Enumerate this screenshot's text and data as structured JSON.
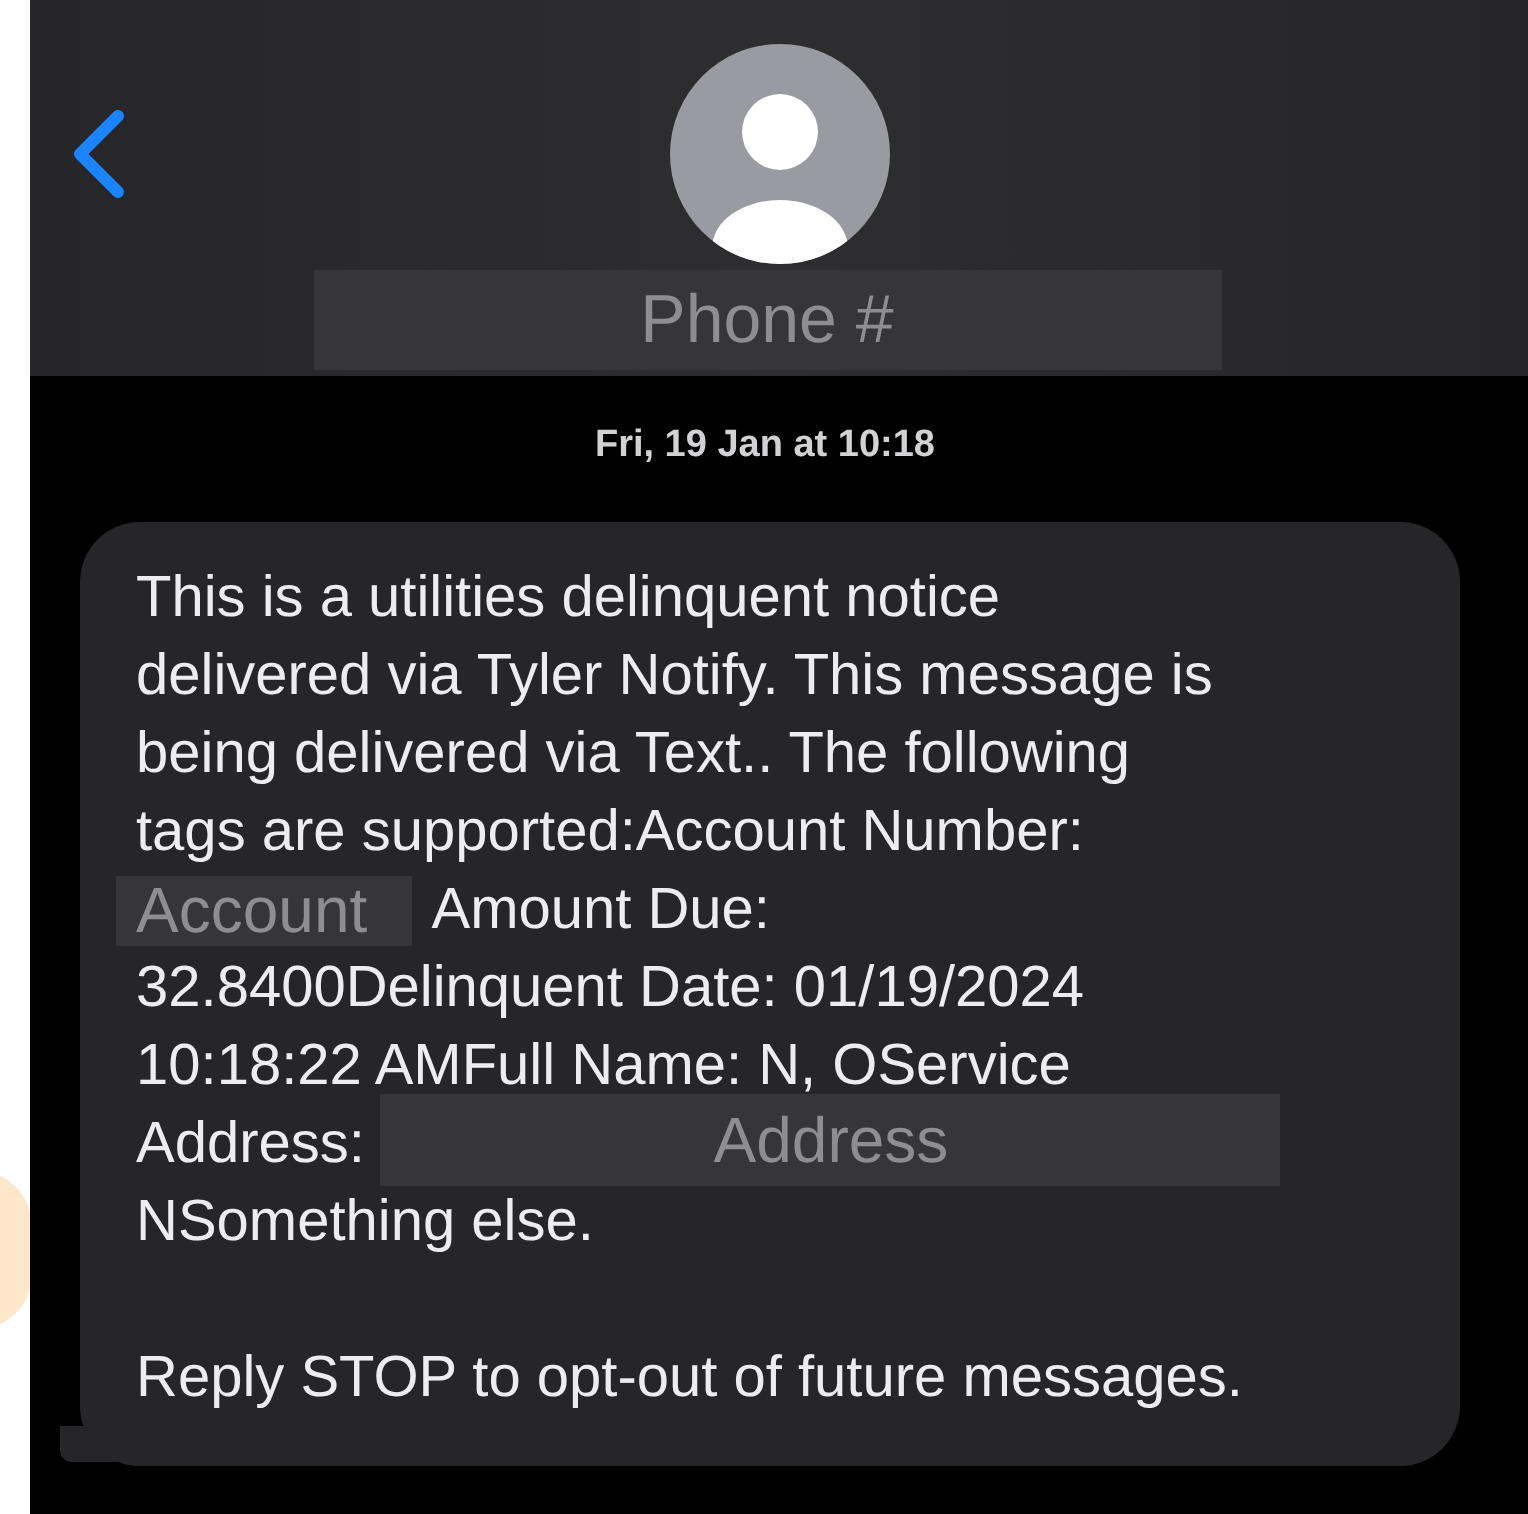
{
  "header": {
    "contact": "Phone #"
  },
  "timestamp": "Fri, 19 Jan at 10:18",
  "message": {
    "paragraphs": [
      [
        [
          {
            "kind": "text",
            "text": "This is a utilities delinquent notice"
          }
        ],
        [
          {
            "kind": "text",
            "text": "delivered via Tyler Notify. This message is"
          }
        ],
        [
          {
            "kind": "text",
            "text": "being delivered via Text.. The following"
          }
        ],
        [
          {
            "kind": "text",
            "text": "tags are supported:Account Number:"
          }
        ],
        [
          {
            "kind": "redacted",
            "text": "Account"
          },
          {
            "kind": "text",
            "text": "Amount Due:"
          }
        ],
        [
          {
            "kind": "text",
            "text": "32.8400Delinquent Date: 01/19/2024"
          }
        ],
        [
          {
            "kind": "text",
            "text": "10:18:22 AMFull Name: N, OService"
          }
        ],
        [
          {
            "kind": "text",
            "text": "Address:"
          },
          {
            "kind": "redacted",
            "text": "Address"
          }
        ],
        [
          {
            "kind": "text",
            "text": "NSomething else."
          }
        ]
      ],
      [
        [
          {
            "kind": "text",
            "text": "Reply STOP to opt-out of future messages."
          }
        ]
      ]
    ]
  }
}
